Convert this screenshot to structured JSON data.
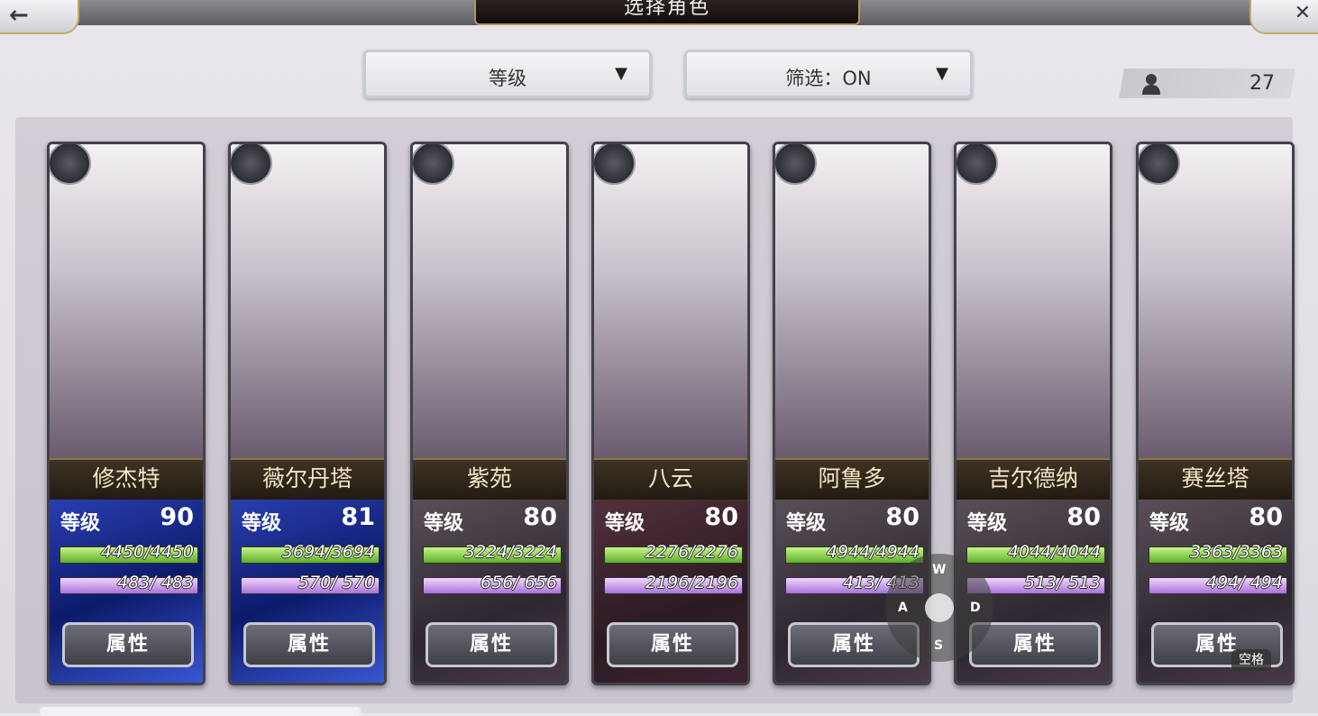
{
  "header": {
    "title": "选择角色",
    "back_icon": "arrow-left-icon",
    "close_icon": "close-icon"
  },
  "sort_dropdown": {
    "value": "等级",
    "caret": "▼"
  },
  "filter_dropdown": {
    "value": "筛选：ON",
    "caret": "▼"
  },
  "character_count": {
    "icon": "person-icon",
    "value": "27"
  },
  "characters": [
    {
      "name": "修杰特",
      "level_label": "等级",
      "level": "90",
      "hp": "4450/4450",
      "mp": "483/ 483",
      "attr_label": "属性",
      "class_icon": "spear-icon",
      "bg": "blue"
    },
    {
      "name": "薇尔丹塔",
      "level_label": "等级",
      "level": "81",
      "hp": "3694/3694",
      "mp": "570/ 570",
      "attr_label": "属性",
      "class_icon": "sword-icon",
      "bg": "blue"
    },
    {
      "name": "紫苑",
      "level_label": "等级",
      "level": "80",
      "hp": "3224/3224",
      "mp": "656/ 656",
      "attr_label": "属性",
      "class_icon": "staff-icon",
      "bg": "dark"
    },
    {
      "name": "八云",
      "level_label": "等级",
      "level": "80",
      "hp": "2276/2276",
      "mp": "2196/2196",
      "attr_label": "属性",
      "class_icon": "staff-icon",
      "bg": "dark2"
    },
    {
      "name": "阿鲁多",
      "level_label": "等级",
      "level": "80",
      "hp": "4944/4944",
      "mp": "413/ 413",
      "attr_label": "属性",
      "class_icon": "sword-icon",
      "bg": "dark"
    },
    {
      "name": "吉尔德纳",
      "level_label": "等级",
      "level": "80",
      "hp": "4044/4044",
      "mp": "513/ 513",
      "attr_label": "属性",
      "class_icon": "sword-icon",
      "bg": "dark"
    },
    {
      "name": "赛丝塔",
      "level_label": "等级",
      "level": "80",
      "hp": "3363/3363",
      "mp": "494/ 494",
      "attr_label": "属性",
      "class_icon": "sword-icon",
      "bg": "dark"
    }
  ],
  "controls": {
    "up": "W",
    "left": "A",
    "down": "S",
    "right": "D",
    "space": "空格"
  }
}
